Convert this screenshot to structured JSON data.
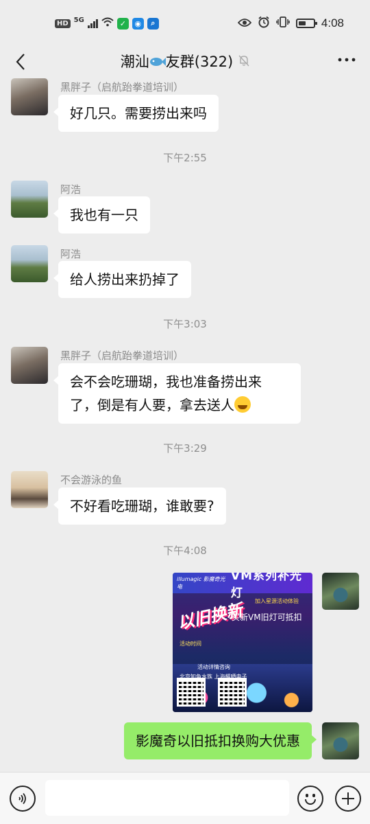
{
  "status_bar": {
    "network_hd": "HD",
    "network_5g": "5G",
    "time": "4:08",
    "icons": [
      "hd-icon",
      "5g-signal-icon",
      "wifi-icon",
      "app-notification-icon",
      "bulb-app-icon",
      "search-app-icon",
      "eye-comfort-icon",
      "alarm-icon",
      "vibrate-icon",
      "battery-icon"
    ]
  },
  "header": {
    "title_pre": "潮汕",
    "title_post": "友群(322)",
    "icons": [
      "back-icon",
      "fish-icon",
      "mute-bell-icon",
      "more-icon"
    ]
  },
  "messages": [
    {
      "sender": "黑胖子（启航跆拳道培训）",
      "text": "好几只。需要捞出来吗"
    },
    {
      "time": "下午2:55"
    },
    {
      "sender": "阿浩",
      "text": "我也有一只"
    },
    {
      "sender": "阿浩",
      "text": "给人捞出来扔掉了"
    },
    {
      "time": "下午3:03"
    },
    {
      "sender": "黑胖子（启航跆拳道培训）",
      "text_line1": "会不会吃珊瑚，我也准备捞出来",
      "text_line2": "了，倒是有人要，拿去送人"
    },
    {
      "time": "下午3:29"
    },
    {
      "sender": "不会游泳的鱼",
      "text": "不好看吃珊瑚，谁敢要?"
    },
    {
      "time": "下午4:08"
    },
    {
      "self_text": "影魔奇以旧抵扣换购大优惠"
    }
  ],
  "poster": {
    "logo": "illumagic 影魔奇光电",
    "title": "VM系列补光灯",
    "tag": "加入星源活动体验",
    "badge": "以旧换新",
    "sub": "买新VM旧灯可抵扣",
    "line1": "活动时间",
    "line2": "活动详情咨询",
    "line3": "北京知鱼水族  上海耀晒电子"
  },
  "input_bar": {
    "value": "",
    "placeholder": ""
  }
}
